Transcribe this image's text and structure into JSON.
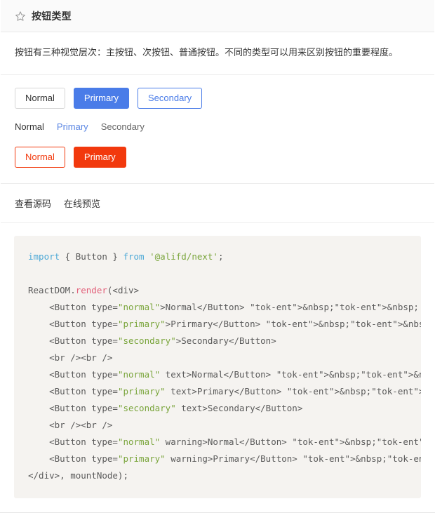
{
  "header": {
    "icon": "star-icon",
    "title": "按钮类型"
  },
  "description": {
    "text": "按钮有三种视觉层次：主按钮、次按钮、普通按钮。不同的类型可以用来区别按钮的重要程度。"
  },
  "demo": {
    "filled_buttons": [
      {
        "label": "Normal",
        "type": "normal"
      },
      {
        "label": "Prirmary",
        "type": "primary"
      },
      {
        "label": "Secondary",
        "type": "secondary"
      }
    ],
    "text_buttons": [
      {
        "label": "Normal",
        "type": "normal"
      },
      {
        "label": "Primary",
        "type": "primary"
      },
      {
        "label": "Secondary",
        "type": "secondary"
      }
    ],
    "warning_buttons": [
      {
        "label": "Normal",
        "type": "normal"
      },
      {
        "label": "Primary",
        "type": "primary"
      }
    ]
  },
  "links": {
    "view_source": "查看源码",
    "online_preview": "在线预览"
  },
  "code": {
    "lines": [
      "import { Button } from '@alifd/next';",
      "",
      "ReactDOM.render(<div>",
      "    <Button type=\"normal\">Normal</Button> &nbsp;&nbsp;",
      "    <Button type=\"primary\">Prirmary</Button> &nbsp;&nbsp;",
      "    <Button type=\"secondary\">Secondary</Button>",
      "    <br /><br />",
      "    <Button type=\"normal\" text>Normal</Button> &nbsp;&nbsp;",
      "    <Button type=\"primary\" text>Primary</Button> &nbsp;&nbsp;",
      "    <Button type=\"secondary\" text>Secondary</Button>",
      "    <br /><br />",
      "    <Button type=\"normal\" warning>Normal</Button> &nbsp;&nbsp;",
      "    <Button type=\"primary\" warning>Primary</Button> &nbsp;&nbsp;",
      "</div>, mountNode);"
    ]
  },
  "colors": {
    "primary": "#4a7ce8",
    "warning": "#f2390d",
    "border": "#d6d6d6",
    "header_bg": "#fafafa",
    "code_bg": "#f5f3f0"
  }
}
